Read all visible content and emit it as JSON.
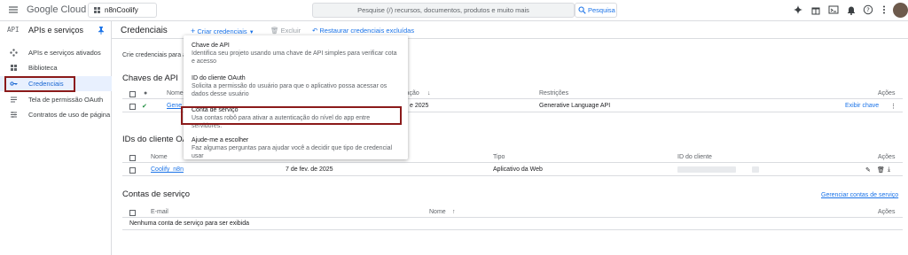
{
  "topbar": {
    "logo_google": "Google",
    "logo_cloud": "Cloud",
    "project": "n8nCoolify",
    "search_placeholder": "Pesquise (/) recursos, documentos, produtos e muito mais",
    "search_button": "Pesquisa"
  },
  "sidebar": {
    "api_mark": "API",
    "title": "APIs e serviços",
    "items": [
      {
        "label": "APIs e serviços ativados"
      },
      {
        "label": "Biblioteca"
      },
      {
        "label": "Credenciais"
      },
      {
        "label": "Tela de permissão OAuth"
      },
      {
        "label": "Contratos de uso de página"
      }
    ]
  },
  "actionbar": {
    "title": "Credenciais",
    "create": "Criar credenciais",
    "delete": "Excluir",
    "restore": "Restaurar credenciais excluídas"
  },
  "description": "Crie credenciais para ac",
  "api_keys": {
    "title": "Chaves de API",
    "headers": {
      "name": "Nome",
      "creation": "iação",
      "restrictions": "Restrições",
      "actions": "Ações"
    },
    "rows": [
      {
        "name": "Gene",
        "date": "e 2025",
        "restriction": "Generative Language API",
        "action": "Exibir chave"
      }
    ]
  },
  "oauth_clients": {
    "title": "IDs do cliente OAu",
    "headers": {
      "name": "Nome",
      "type": "Tipo",
      "client_id": "ID do cliente",
      "actions": "Ações"
    },
    "rows": [
      {
        "name": "Coolify_n8n",
        "date": "7 de fev. de 2025",
        "type": "Aplicativo da Web"
      }
    ]
  },
  "service_accounts": {
    "title": "Contas de serviço",
    "manage_link": "Gerenciar contas de serviço",
    "headers": {
      "email": "E-mail",
      "name": "Nome",
      "actions": "Ações"
    },
    "empty": "Nenhuma conta de serviço para ser exibida"
  },
  "dropdown": {
    "items": [
      {
        "title": "Chave de API",
        "desc": "Identifica seu projeto usando uma chave de API simples para verificar cota e acesso"
      },
      {
        "title": "ID do cliente OAuth",
        "desc": "Solicita a permissão do usuário para que o aplicativo possa acessar os dados desse usuário"
      },
      {
        "title": "Conta de serviço",
        "desc": "Usa contas robô para ativar a autenticação do nível do app entre servidores."
      },
      {
        "title": "Ajude-me a escolher",
        "desc": "Faz algumas perguntas para ajudar você a decidir que tipo de credencial usar"
      }
    ]
  },
  "colors": {
    "accent": "#1a73e8",
    "highlight": "#8b1a1a",
    "active_bg": "#e8f0fe"
  }
}
